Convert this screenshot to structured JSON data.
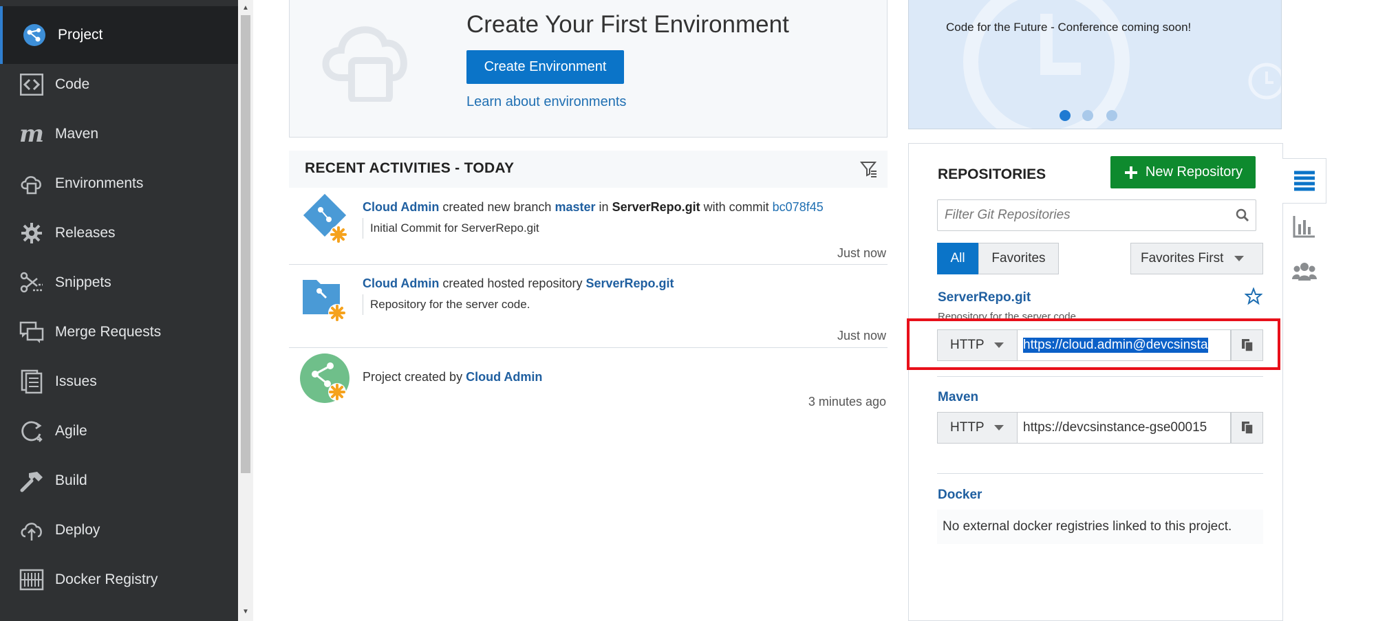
{
  "sidebar": {
    "items": [
      {
        "label": "Project",
        "icon": "project-icon"
      },
      {
        "label": "Code",
        "icon": "code-icon"
      },
      {
        "label": "Maven",
        "icon": "maven-icon"
      },
      {
        "label": "Environments",
        "icon": "environments-icon"
      },
      {
        "label": "Releases",
        "icon": "releases-icon"
      },
      {
        "label": "Snippets",
        "icon": "snippets-icon"
      },
      {
        "label": "Merge Requests",
        "icon": "merge-requests-icon"
      },
      {
        "label": "Issues",
        "icon": "issues-icon"
      },
      {
        "label": "Agile",
        "icon": "agile-icon"
      },
      {
        "label": "Build",
        "icon": "build-icon"
      },
      {
        "label": "Deploy",
        "icon": "deploy-icon"
      },
      {
        "label": "Docker Registry",
        "icon": "docker-registry-icon"
      }
    ]
  },
  "environment": {
    "title": "Create Your First Environment",
    "button": "Create Environment",
    "link": "Learn about environments"
  },
  "activities": {
    "header": "RECENT ACTIVITIES - TODAY",
    "items": [
      {
        "user": "Cloud Admin",
        "action1": "created new branch",
        "branch": "master",
        "in": "in",
        "repo": "ServerRepo.git",
        "with_commit": "with commit",
        "commit": "bc078f45",
        "message": "Initial Commit for ServerRepo.git",
        "time": "Just now"
      },
      {
        "user": "Cloud Admin",
        "action1": "created hosted repository",
        "repo": "ServerRepo.git",
        "message": "Repository for the server code.",
        "time": "Just now"
      },
      {
        "prefix": "Project created by",
        "user": "Cloud Admin",
        "time": "3 minutes ago"
      }
    ]
  },
  "promo": {
    "text": "Code for the Future - Conference coming soon!",
    "active_slide": 1,
    "slide_count": 3
  },
  "repositories": {
    "title": "REPOSITORIES",
    "new_button": "New Repository",
    "search_placeholder": "Filter Git Repositories",
    "filter_all": "All",
    "filter_favorites": "Favorites",
    "sort": "Favorites First",
    "repo": {
      "name": "ServerRepo.git",
      "description": "Repository for the server code.",
      "protocol": "HTTP",
      "url": "https://cloud.admin@devcsinsta"
    },
    "maven": {
      "title": "Maven",
      "protocol": "HTTP",
      "url": "https://devcsinstance-gse00015"
    },
    "docker": {
      "title": "Docker",
      "message": "No external docker registries linked to this project."
    }
  },
  "colors": {
    "accent": "#0b74c8",
    "success": "#0e8a2e",
    "highlight": "#e8101a",
    "sidebar": "#2f3133"
  }
}
